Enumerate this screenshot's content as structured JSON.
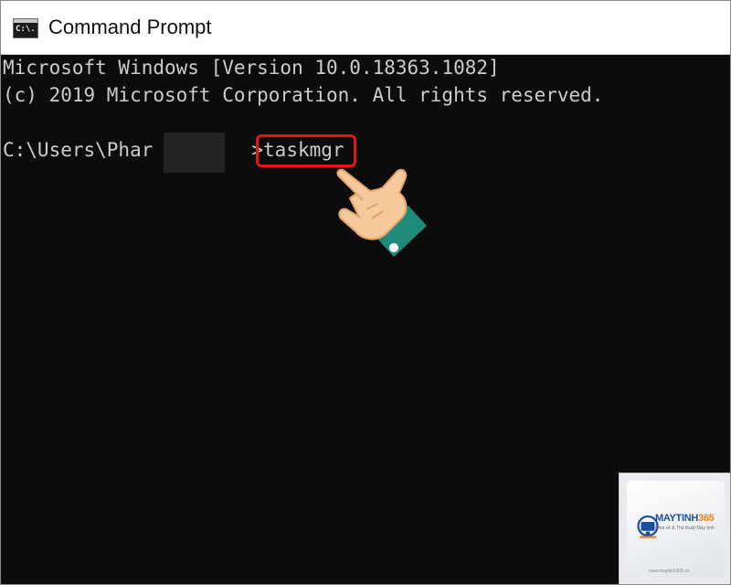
{
  "window": {
    "title": "Command Prompt",
    "icon_name": "cmd-app-icon",
    "icon_text": "C:\\."
  },
  "console": {
    "lines": [
      "Microsoft Windows [Version 10.0.18363.1082]",
      "(c) 2019 Microsoft Corporation. All rights reserved."
    ],
    "prompt_prefix": "C:\\Users\\Phar",
    "prompt_suffix": ">",
    "typed_command": "taskmgr"
  },
  "annotation": {
    "highlight_color": "#e01818",
    "pointer_icon": "pointing-hand-icon"
  },
  "watermark": {
    "brand_main": "MAYTINH",
    "brand_accent": "365",
    "tagline": "Chia sẻ & Thủ thuật Máy tính",
    "footer": "www.maytinh365.vn"
  },
  "colors": {
    "console_bg": "#0c0c0c",
    "console_fg": "#cccccc",
    "brand_blue": "#1d4ea0",
    "brand_orange": "#e8801c"
  }
}
